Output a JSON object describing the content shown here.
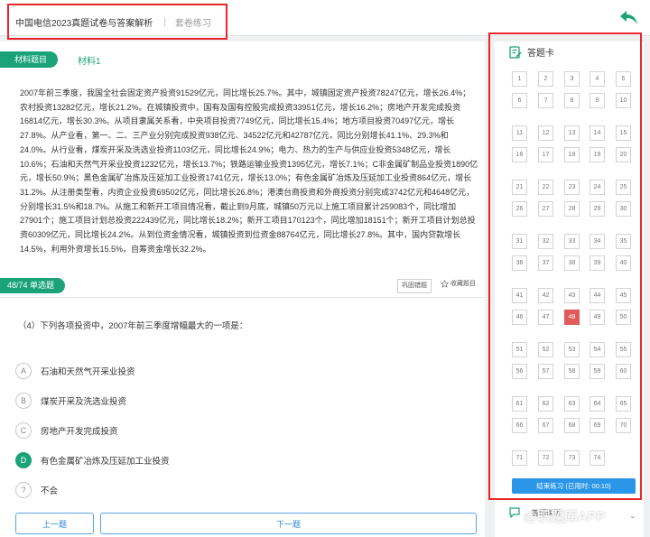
{
  "header": {
    "title": "中国电信2023真题试卷与答案解析",
    "separator": "|",
    "mode": "套卷练习"
  },
  "material": {
    "tag_label": "材料题目",
    "tab_label": "材料1",
    "paragraphs": [
      "2007年前三季度，我国全社会固定资产投资91529亿元，同比增长25.7%。其中，城镇固定资产投资78247亿元，增长26.4%；农村投资13282亿元，增长21.2%。在城镇投资中，国有及国有控股完成投资33951亿元，增长16.2%；房地产开发完成投资16814亿元，增长30.3%。从项目隶属关系看，中央项目投资7749亿元，同比增长15.4%；地方项目投资70497亿元，增长27.8%。从产业看，第一、二、三产业分别完成投资938亿元、34522亿元和42787亿元，同比分别增长41.1%、29.3%和24.0%。从行业看，煤炭开采及洗选业投资1103亿元，同比增长24.9%；电力、热力的生产与供应业投资5348亿元，增长10.6%；石油和天然气开采业投资1232亿元，增长13.7%；铁路运输业投资1395亿元，增长7.1%；C非金属矿制品业投资1890亿元，增长50.9%；黑色金属矿冶炼及压延加工业投资1741亿元，增长13.0%；有色金属矿冶炼及压延加工业投资864亿元，增长31.2%。从注册类型看，内资企业投资69502亿元，同比增长26.8%；港澳台商投资和外商投资分别完成3742亿元和4648亿元，分别增长31.5%和18.7%。从施工和新开工项目情况看，截止到9月底，城镇50万元以上施工项目累计259083个，同比增加27901个；施工项目计划总投资222439亿元，同比增长18.2%；新开工项目170123个，同比增加18151个；新开工项目计划总投资60309亿元，同比增长24.2%。从到位资金情况看，城镇投资到位资金88764亿元，同比增长27.8%。其中，国内贷款增长14.5%，利用外资增长15.5%，自筹资金增长32.2%。"
    ]
  },
  "question": {
    "tag_label": "48/74 单选题",
    "consolidate_label": "巩固错题",
    "favorite_label": "收藏题目",
    "text": "（4）下列各项投资中，2007年前三季度增幅最大的一项是：",
    "options": [
      {
        "letter": "A",
        "text": "石油和天然气开采业投资",
        "selected": false
      },
      {
        "letter": "B",
        "text": "煤炭开采及洗选业投资",
        "selected": false
      },
      {
        "letter": "C",
        "text": "房地产开发完成投资",
        "selected": false
      },
      {
        "letter": "D",
        "text": "有色金属矿冶炼及压延加工业投资",
        "selected": true
      },
      {
        "letter": "?",
        "text": "不会",
        "selected": false
      }
    ],
    "prev_label": "上一题",
    "next_label": "下一题"
  },
  "answer_card": {
    "title": "答题卡",
    "total": 74,
    "current": 48,
    "finish_label": "结束练习 (已用时: 00:10)"
  },
  "footer": {
    "below_label": "答题说明",
    "watermark": "@职题库APP"
  },
  "colors": {
    "accent_green": "#1aa377",
    "current_red": "#e15a5a",
    "finish_blue": "#2b96e8",
    "highlight_red": "#e8262b"
  }
}
